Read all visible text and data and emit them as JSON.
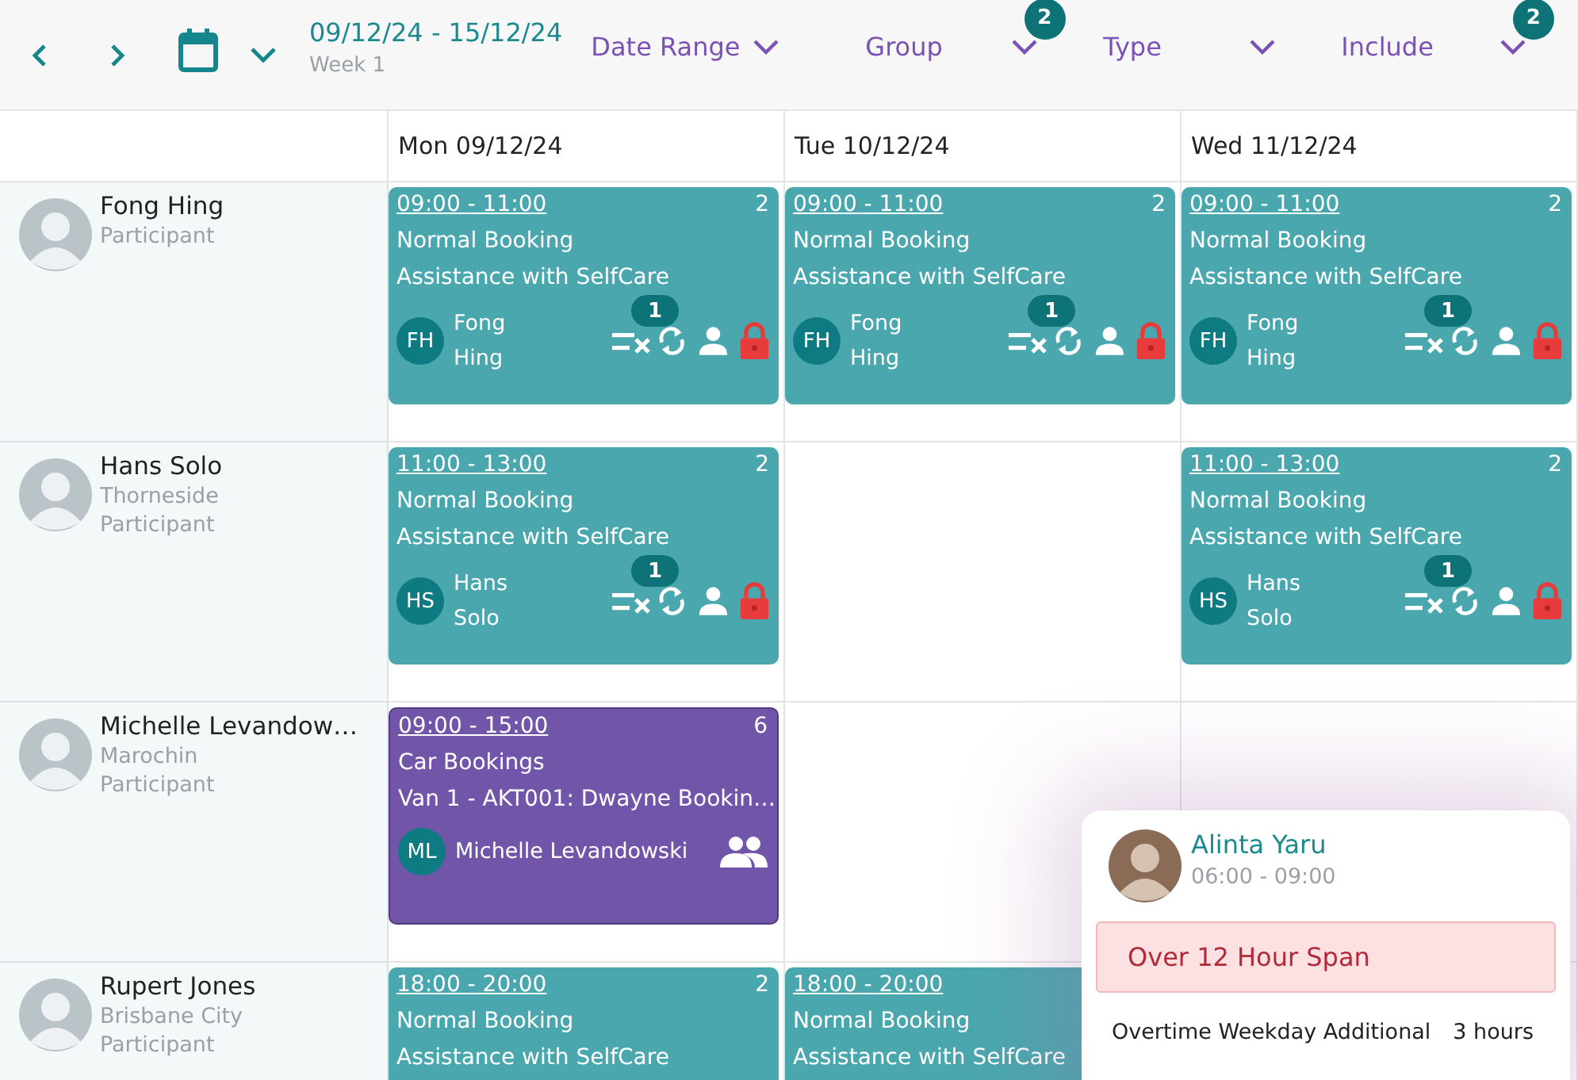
{
  "toolbar": {
    "date_range": "09/12/24 - 15/12/24",
    "week": "Week 1",
    "filters": [
      {
        "label": "Date Range"
      },
      {
        "label": "Group",
        "badge": "2"
      },
      {
        "label": "Type"
      },
      {
        "label": "Include",
        "badge": "2"
      }
    ]
  },
  "days": [
    "Mon 09/12/24",
    "Tue 10/12/24",
    "Wed 11/12/24"
  ],
  "rows": [
    {
      "name": "Fong Hing",
      "details": [
        "Participant"
      ],
      "cells": [
        {
          "kind": "normal",
          "time": "09:00 - 11:00",
          "count": "2",
          "title": "Normal Booking",
          "subtitle": "Assistance with SelfCare",
          "initials": "FH",
          "person": "Fong Hing",
          "badge": "1"
        },
        {
          "kind": "normal",
          "time": "09:00 - 11:00",
          "count": "2",
          "title": "Normal Booking",
          "subtitle": "Assistance with SelfCare",
          "initials": "FH",
          "person": "Fong Hing",
          "badge": "1"
        },
        {
          "kind": "normal",
          "time": "09:00 - 11:00",
          "count": "2",
          "title": "Normal Booking",
          "subtitle": "Assistance with SelfCare",
          "initials": "FH",
          "person": "Fong Hing",
          "badge": "1"
        }
      ]
    },
    {
      "name": "Hans Solo",
      "details": [
        "Thorneside",
        "Participant"
      ],
      "cells": [
        {
          "kind": "normal",
          "time": "11:00 - 13:00",
          "count": "2",
          "title": "Normal Booking",
          "subtitle": "Assistance with SelfCare",
          "initials": "HS",
          "person": "Hans Solo",
          "badge": "1"
        },
        null,
        {
          "kind": "normal",
          "time": "11:00 - 13:00",
          "count": "2",
          "title": "Normal Booking",
          "subtitle": "Assistance with SelfCare",
          "initials": "HS",
          "person": "Hans Solo",
          "badge": "1"
        }
      ]
    },
    {
      "name": "Michelle Levandow…",
      "details": [
        "Marochin",
        "Participant"
      ],
      "cells": [
        {
          "kind": "group",
          "time": "09:00 - 15:00",
          "count": "6",
          "title": "Car Bookings",
          "subtitle": "Van 1 - AKT001: Dwayne Bookin…",
          "initials": "ML",
          "person": "Michelle Levandowski"
        },
        null,
        null
      ]
    },
    {
      "name": "Rupert Jones",
      "details": [
        "Brisbane City",
        "Participant"
      ],
      "cells": [
        {
          "kind": "normal",
          "time": "18:00 - 20:00",
          "count": "2",
          "title": "Normal Booking",
          "subtitle": "Assistance with SelfCare"
        },
        {
          "kind": "normal",
          "time": "18:00 - 20:00",
          "title": "Normal Booking",
          "subtitle": "Assistance with SelfCare"
        },
        null
      ]
    }
  ],
  "popup": {
    "name": "Alinta Yaru",
    "time": "06:00 - 09:00",
    "alert": "Over 12 Hour Span",
    "line": {
      "label": "Overtime Weekday Additional",
      "value": "3 hours"
    }
  }
}
